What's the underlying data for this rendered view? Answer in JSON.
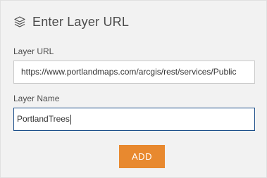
{
  "dialog": {
    "title": "Enter Layer URL",
    "title_icon": "layers-icon"
  },
  "layer_url": {
    "label": "Layer URL",
    "value": "https://www.portlandmaps.com/arcgis/rest/services/Public"
  },
  "layer_name": {
    "label": "Layer Name",
    "value": "PortlandTrees"
  },
  "actions": {
    "add_label": "ADD"
  },
  "colors": {
    "panel_background": "#f2f2f2",
    "accent_button": "#e8892f",
    "focused_border": "#1c4f8a",
    "text": "#4c4c4c"
  }
}
